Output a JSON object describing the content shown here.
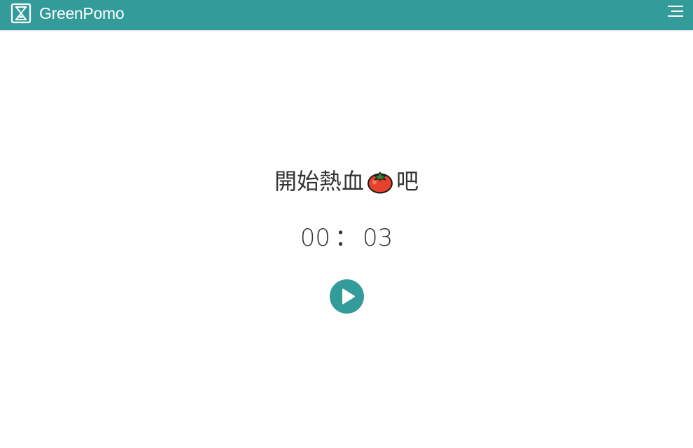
{
  "navbar": {
    "brand_icon": "hourglass-icon",
    "brand_name": "GreenPomo",
    "menu_icon": "hamburger-menu-icon",
    "background": "#339b9a"
  },
  "main": {
    "headline_before": "開始熱血",
    "headline_icon": "tomato-icon",
    "headline_after": "吧",
    "timer": {
      "minutes": "00",
      "separator": "：",
      "seconds": "03"
    },
    "play_button_icon": "play-icon",
    "accent": "#339b9a"
  }
}
